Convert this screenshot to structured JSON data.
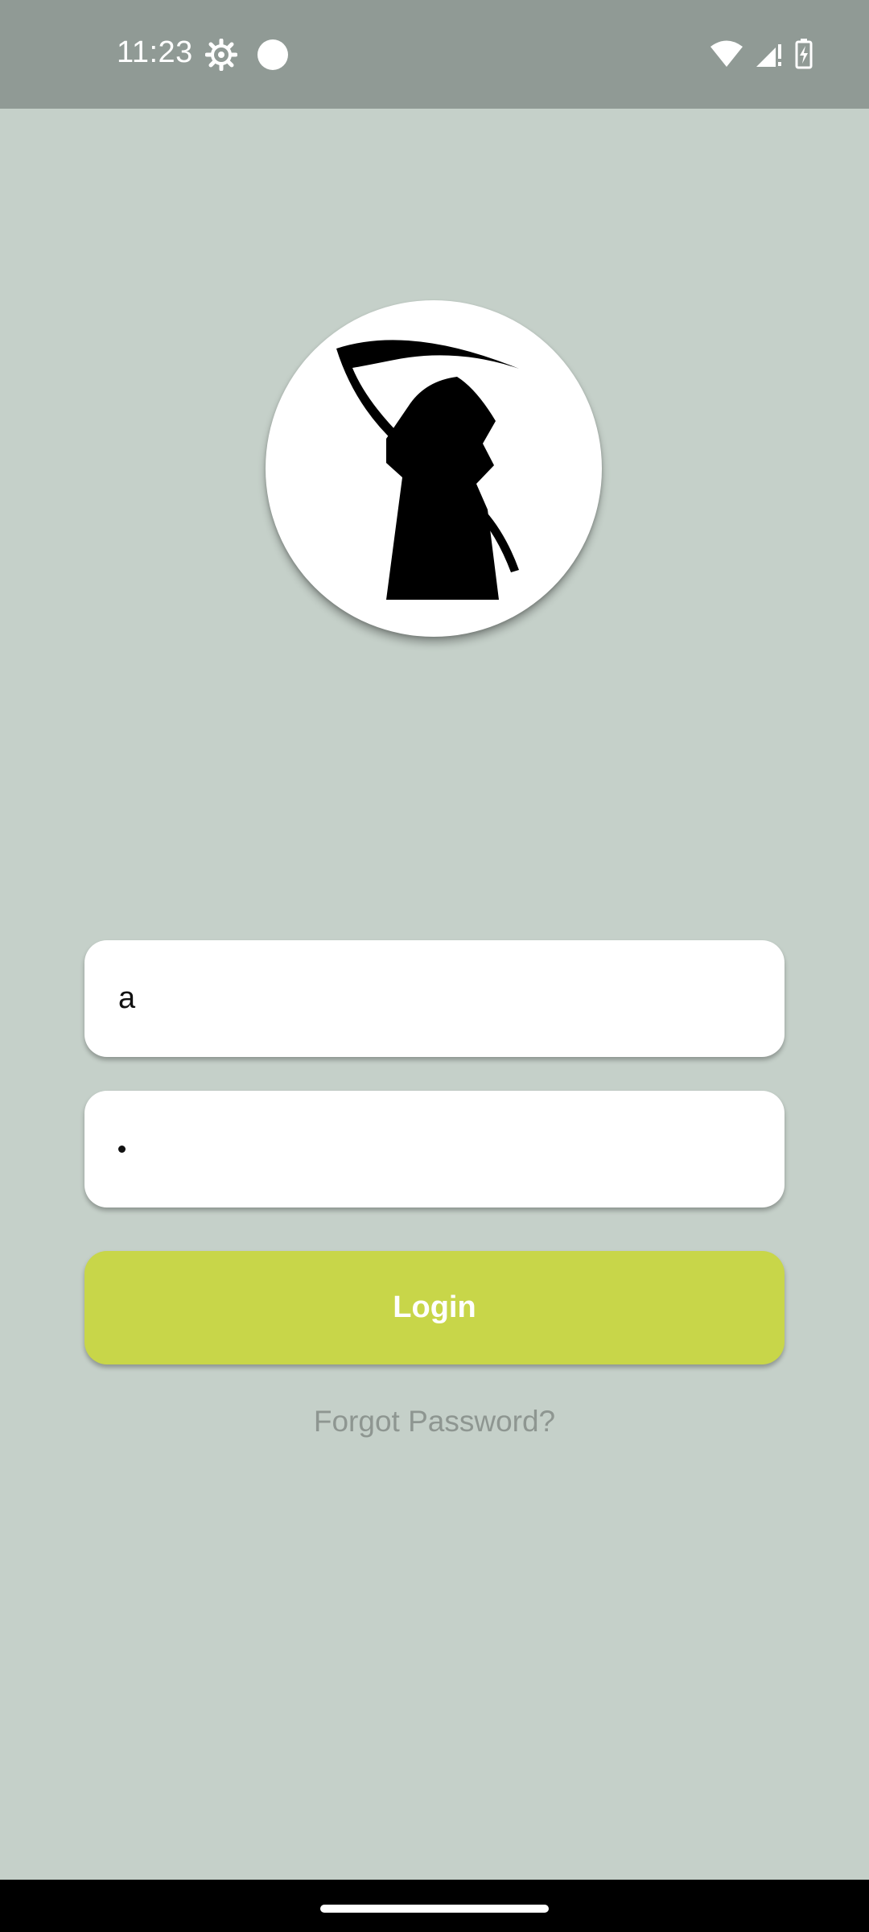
{
  "status_bar": {
    "time": "11:23",
    "left_icons": [
      "settings-gear-icon",
      "notification-dot-icon"
    ],
    "right_icons": [
      "wifi-icon",
      "cellular-no-signal-icon",
      "battery-charging-icon"
    ],
    "background": "#909a95"
  },
  "app": {
    "logo": "grim-reaper-logo",
    "background": "#c5d0c9"
  },
  "login_form": {
    "username_value": "a",
    "password_masked_length": 1,
    "login_label": "Login",
    "login_color": "#c8d649",
    "forgot_password_label": "Forgot Password?"
  },
  "nav_bar": {
    "home_indicator": "home-indicator"
  }
}
